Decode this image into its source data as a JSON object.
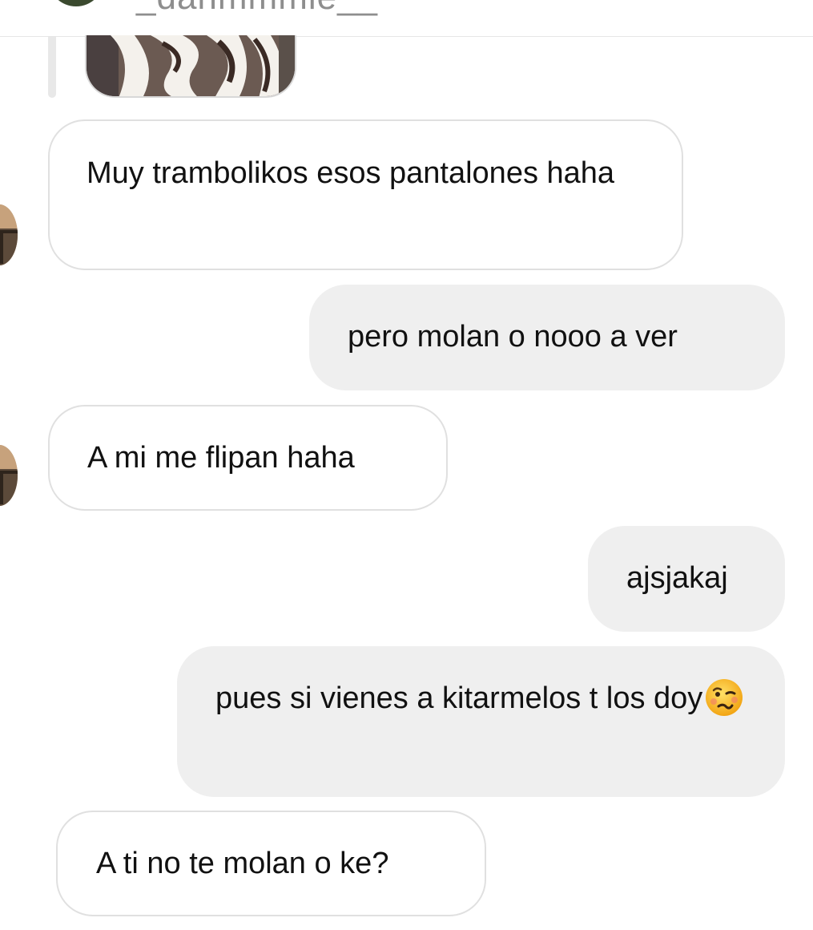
{
  "header": {
    "username": "_danmmmie__"
  },
  "messages": [
    {
      "from": "them",
      "text": "Muy trambolikos esos pantalones haha"
    },
    {
      "from": "me",
      "text": "pero molan o nooo a ver"
    },
    {
      "from": "them",
      "text": "A mi me flipan haha"
    },
    {
      "from": "me",
      "text": "ajsjakaj"
    },
    {
      "from": "me",
      "text": "pues si vienes a kitarmelos t los doy",
      "emoji": "woozy-face"
    },
    {
      "from": "them",
      "text": "A ti no te molan o ke?"
    }
  ],
  "colors": {
    "incoming_bubble": "#ffffff",
    "incoming_border": "#e0e0e0",
    "outgoing_bubble": "#efefef",
    "text": "#111111"
  }
}
